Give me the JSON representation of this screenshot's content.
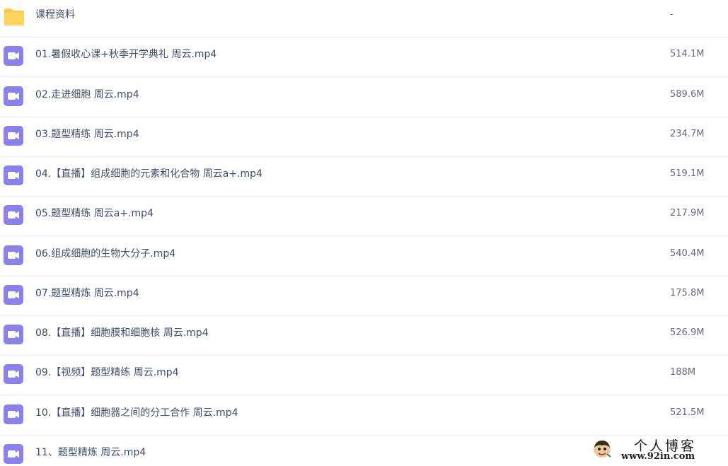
{
  "files": [
    {
      "name": "课程资料",
      "size": "-",
      "icon": "folder-icon"
    },
    {
      "name": "01.暑假收心课+秋季开学典礼 周云.mp4",
      "size": "514.1M",
      "icon": "video-icon"
    },
    {
      "name": "02.走进细胞 周云.mp4",
      "size": "589.6M",
      "icon": "video-icon"
    },
    {
      "name": "03.题型精练 周云.mp4",
      "size": "234.7M",
      "icon": "video-icon"
    },
    {
      "name": "04.【直播】组成细胞的元素和化合物 周云a+.mp4",
      "size": "519.1M",
      "icon": "video-icon"
    },
    {
      "name": "05.题型精练 周云a+.mp4",
      "size": "217.9M",
      "icon": "video-icon"
    },
    {
      "name": "06.组成细胞的生物大分子.mp4",
      "size": "540.4M",
      "icon": "video-icon"
    },
    {
      "name": "07.题型精炼 周云.mp4",
      "size": "175.8M",
      "icon": "video-icon"
    },
    {
      "name": "08.【直播】细胞膜和细胞核 周云.mp4",
      "size": "526.9M",
      "icon": "video-icon"
    },
    {
      "name": "09.【视频】题型精练 周云.mp4",
      "size": "188M",
      "icon": "video-icon"
    },
    {
      "name": "10.【直播】细胞器之间的分工合作 周云.mp4",
      "size": "521.5M",
      "icon": "video-icon"
    },
    {
      "name": "11、题型精炼 周云.mp4",
      "size": "",
      "icon": "video-icon"
    }
  ],
  "watermark": {
    "title": "个人博客",
    "url": "www.92in.com"
  },
  "colors": {
    "folder": "#ffc94a",
    "video": "#8b80f0",
    "name_text": "#424e67",
    "size_text": "#666b78",
    "divider": "#f1f1f3"
  }
}
